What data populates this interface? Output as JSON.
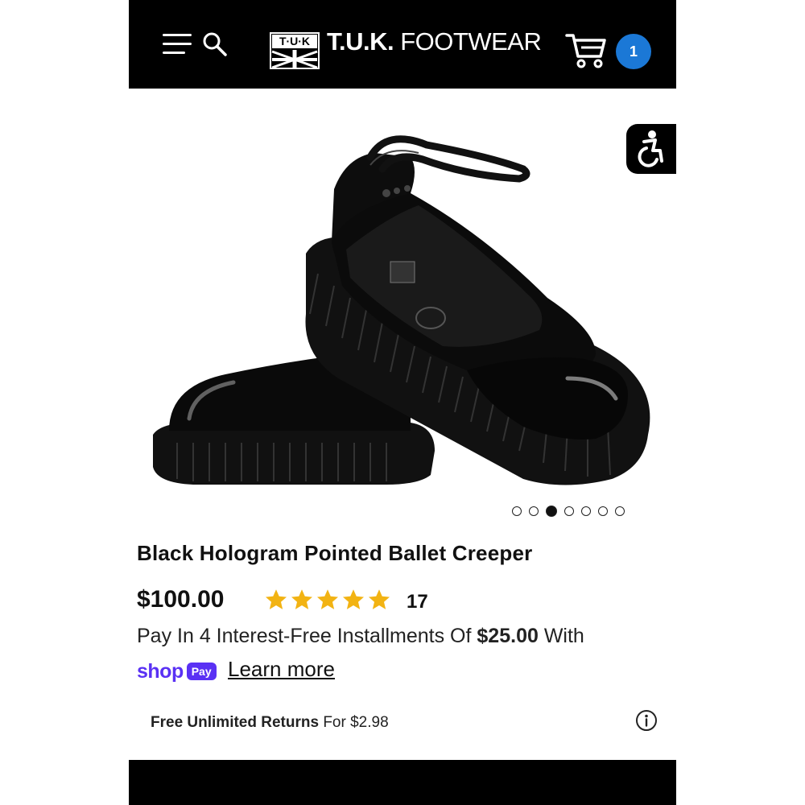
{
  "header": {
    "menu_icon": "hamburger-icon",
    "search_icon": "search-icon",
    "logo_text": "T·U·K",
    "brand_bold": "T.U.K.",
    "brand_light": "FOOTWEAR",
    "cart_icon": "cart-icon",
    "cart_count": "1",
    "badge_color": "#1b78d6"
  },
  "accessibility": {
    "icon": "accessibility-icon"
  },
  "gallery": {
    "image_alt": "Black patent pointed ballet creeper with ankle strap",
    "dot_count": 7,
    "active_dot": 3
  },
  "product": {
    "title": "Black Hologram Pointed Ballet Creeper",
    "price": "$100.00",
    "rating": 5,
    "rating_max": 5,
    "star_color": "#f2b313",
    "review_count": "17"
  },
  "payment": {
    "installments_prefix": "Pay In 4 Interest-Free Installments Of",
    "installment_amount": "$25.00",
    "installments_suffix": "With",
    "shop_word": "shop",
    "pay_word": "Pay",
    "shop_color": "#5a31f4",
    "learn_more": "Learn more"
  },
  "returns": {
    "bold": "Free Unlimited Returns",
    "rest": "For $2.98",
    "info_icon": "info-icon"
  }
}
